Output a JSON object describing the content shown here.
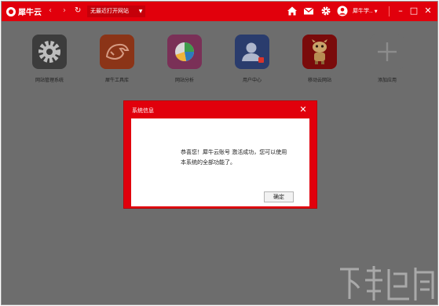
{
  "titlebar": {
    "brand": "犀牛云",
    "address": "无最近打开网站",
    "user": "犀牛学..",
    "icons": [
      "back-icon",
      "forward-icon",
      "refresh-icon",
      "dropdown-icon",
      "home-icon",
      "mail-icon",
      "gear-icon",
      "user-icon",
      "minimize-icon",
      "maximize-icon",
      "close-icon"
    ]
  },
  "apps": [
    {
      "label": "网站管理系统",
      "icon": "gear-icon",
      "color": "#3c3c3c"
    },
    {
      "label": "犀牛工具库",
      "icon": "rhino-icon",
      "color": "#8b3417"
    },
    {
      "label": "网站分析",
      "icon": "pie-chart-icon",
      "color": "#7a3057"
    },
    {
      "label": "用户中心",
      "icon": "person-icon",
      "color": "#2a3c6d"
    },
    {
      "label": "移动云网站",
      "icon": "mascot-icon",
      "color": "#7a0b0b"
    },
    {
      "label": "添加应用",
      "icon": "plus-icon",
      "color": "#6d6d6d"
    }
  ],
  "dialog": {
    "title": "系统信息",
    "message": "恭喜您！犀牛云账号 激活成功，您可以使用本系统的全部功能了。",
    "ok_label": "确定"
  }
}
